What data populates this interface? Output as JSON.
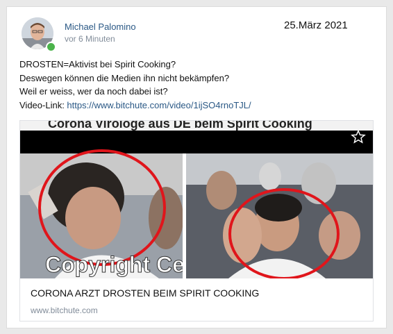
{
  "post": {
    "author": "Michael Palomino",
    "time": "vor 6 Minuten",
    "date": "25.März 2021",
    "lines": [
      "DROSTEN=Aktivist bei Spirit Cooking?",
      "Deswegen können die Medien ihn nicht bekämpfen?",
      "Weil er weiss, wer da noch dabei ist?"
    ],
    "link_label": "Video-Link: ",
    "link_url": "https://www.bitchute.com/video/1ijSO4rnoTJL/"
  },
  "preview": {
    "banner_text": "Corona Virologe aus DE beim Spirit Cooking",
    "overlay_text": "Copyright Celebr",
    "title": "CORONA ARZT DROSTEN BEIM SPIRIT COOKING",
    "domain": "www.bitchute.com",
    "icons": {
      "favorite": "star-icon",
      "online": "online-indicator"
    },
    "colors": {
      "link": "#2a5885",
      "highlight_circle": "#e0151b",
      "online": "#4bb34b"
    }
  }
}
